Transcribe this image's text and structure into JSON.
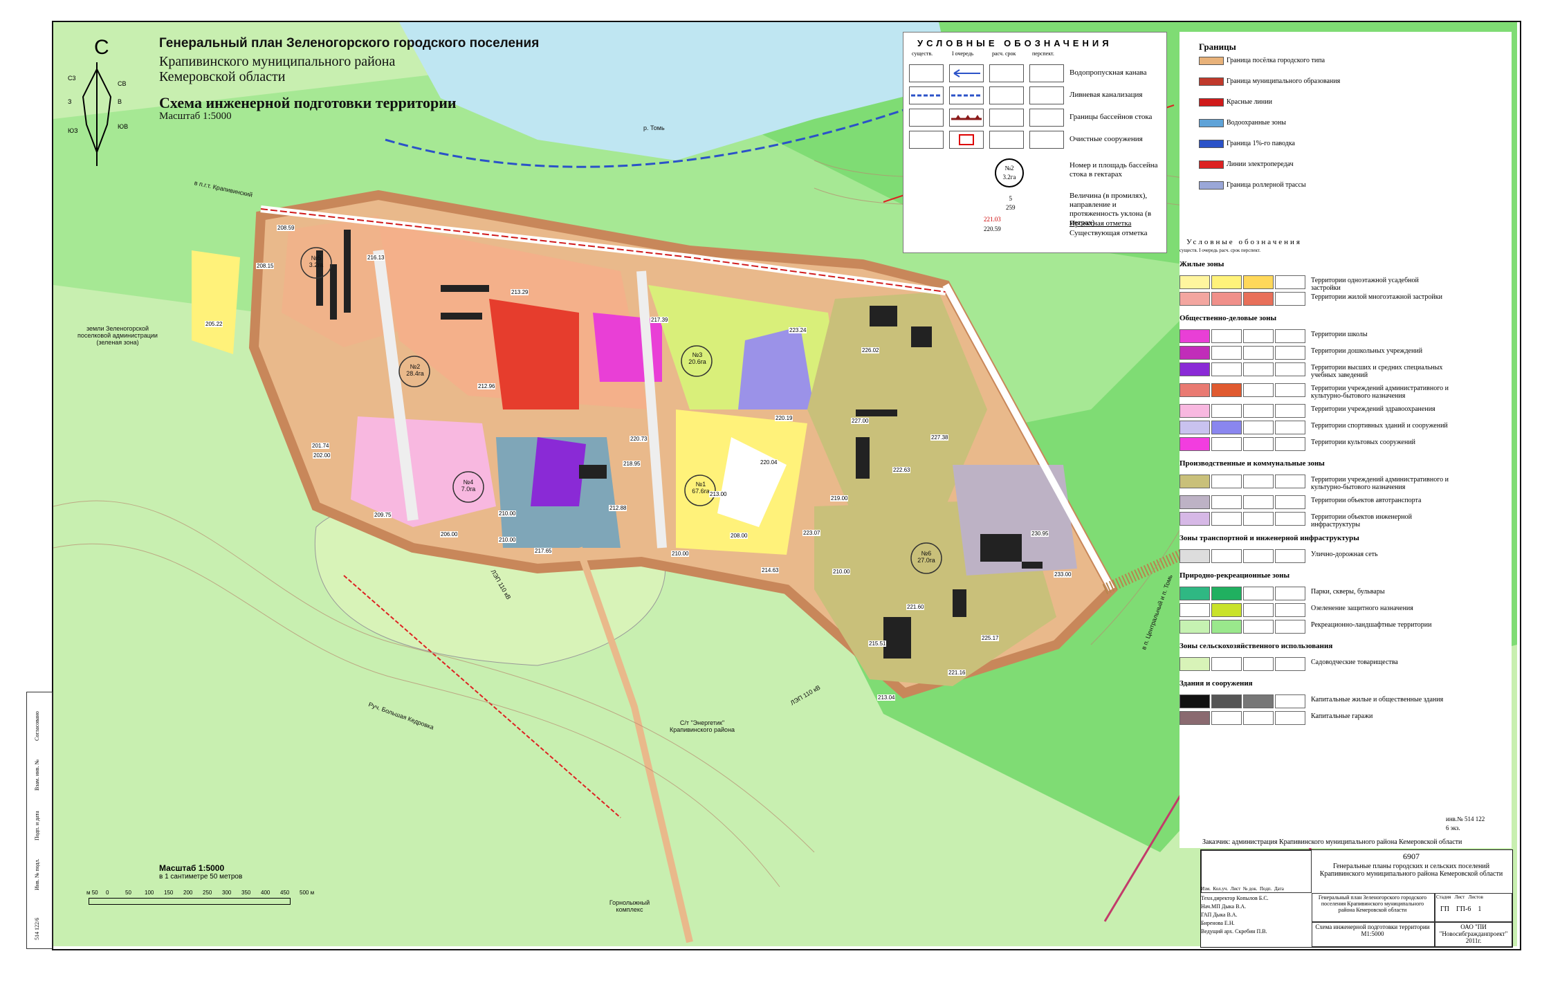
{
  "title": {
    "line1": "Генеральный план Зеленогорского городского поселения",
    "line2": "Крапивинского муниципального района",
    "line3": "Кемеровской области",
    "scheme": "Схема инженерной подготовки территории",
    "scale": "Масштаб 1:5000"
  },
  "north": "С",
  "compass": [
    "С3",
    "СВ",
    "З",
    "В",
    "ЮЗ",
    "ЮВ"
  ],
  "map_labels": {
    "river": "р. Томь",
    "village_lands": "земли Зеленогорской поселковой администрации (зеленая зона)",
    "dacha": "С/т \"Энергетик\" Крапивинского района",
    "ski": "Горнолыжный комплекс",
    "stream": "Руч. Большая Кедровка",
    "road_krap": "в п.г.т. Крапивинский",
    "road_central": "в п. Центральный и п. Томь",
    "lep1": "ЛЭП 110 кВ",
    "lep2": "ЛЭП 110 кВ"
  },
  "basins": [
    {
      "id": "№1",
      "area": "67.6га"
    },
    {
      "id": "№2",
      "area": "28.4га"
    },
    {
      "id": "№3",
      "area": "20.6га"
    },
    {
      "id": "№4",
      "area": "7.0га"
    },
    {
      "id": "№5",
      "area": "3.2га"
    },
    {
      "id": "№6",
      "area": "27.0га"
    }
  ],
  "elevations": [
    "208.59",
    "216.13",
    "213.29",
    "217.39",
    "223.24",
    "226.02",
    "227.38",
    "222.63",
    "230.95",
    "233.00",
    "225.17",
    "221.16",
    "213.04",
    "221.60",
    "215.51",
    "210.00",
    "214.63",
    "208.00",
    "220.04",
    "210.00",
    "212.88",
    "210.00",
    "206.00",
    "201.74",
    "202.00",
    "205.22",
    "208.15",
    "212.96",
    "220.73",
    "218.95",
    "213.00",
    "209.75",
    "217.65",
    "210.00",
    "223.07",
    "219.00",
    "227.00",
    "220.19"
  ],
  "legend1": {
    "heading": "УСЛОВНЫЕ ОБОЗНАЧЕНИЯ",
    "cols": [
      "существ.",
      "I очередь",
      "расч. срок",
      "перспект."
    ],
    "rows": [
      {
        "label": "Водопропускная канава"
      },
      {
        "label": "Ливневая канализация"
      },
      {
        "label": "Границы бассейнов стока"
      },
      {
        "label": "Очистные сооружения"
      },
      {
        "label": "Номер и площадь бассейна стока в гектарах"
      },
      {
        "label": "Величина (в промилях), направление и протяженность уклона (в метрах)"
      },
      {
        "label": "Проектная отметка"
      },
      {
        "label": "Существующая отметка"
      }
    ],
    "sample_basin": {
      "id": "№2",
      "area": "3.2га"
    },
    "sample_slope": {
      "value": "5",
      "length": "259"
    },
    "sample_elev": {
      "project": "221.03",
      "exist": "220.59"
    }
  },
  "legend_borders": {
    "heading": "Границы",
    "items": [
      {
        "label": "Граница посёлка городского типа",
        "color": "#e8b27a"
      },
      {
        "label": "Граница муниципального образования",
        "color": "#c0392b"
      },
      {
        "label": "Красные линии",
        "color": "#d01a1a"
      },
      {
        "label": "Водоохранные зоны",
        "color": "#5fa3d8"
      },
      {
        "label": "Граница 1%-го паводка",
        "color": "#2b52c8"
      },
      {
        "label": "Линии электропередач",
        "color": "#d22"
      },
      {
        "label": "Граница роллерной трассы",
        "color": "#9aa7d8"
      }
    ]
  },
  "legend2": {
    "heading": "Условные обозначения",
    "cols": [
      "существ.",
      "I очередь",
      "расч. срок",
      "перспект."
    ],
    "sections": [
      {
        "title": "Жилые зоны",
        "items": [
          {
            "label": "Территории одноэтажной усадебной застройки",
            "colors": [
              "#fff59e",
              "#fff27a",
              "#ffd85a",
              "#ffffff"
            ]
          },
          {
            "label": "Территории жилой многоэтажной застройки",
            "colors": [
              "#f3a6a0",
              "#f0908a",
              "#e8705a",
              "#ffffff"
            ]
          }
        ]
      },
      {
        "title": "Общественно-деловые зоны",
        "items": [
          {
            "label": "Территории школы",
            "colors": [
              "#e93fd6",
              "#ffffff",
              "#ffffff",
              "#ffffff"
            ]
          },
          {
            "label": "Территории дошкольных учреждений",
            "colors": [
              "#c12db9",
              "#ffffff",
              "#ffffff",
              "#ffffff"
            ]
          },
          {
            "label": "Территории высших и средних специальных учебных заведений",
            "colors": [
              "#8a2ad6",
              "#ffffff",
              "#ffffff",
              "#ffffff"
            ]
          },
          {
            "label": "Территории учреждений административного и культурно-бытового назначения",
            "colors": [
              "#e97a72",
              "#e05a30",
              "#ffffff",
              "#ffffff"
            ]
          },
          {
            "label": "Территории учреждений здравоохранения",
            "colors": [
              "#f8b8e0",
              "#ffffff",
              "#ffffff",
              "#ffffff"
            ]
          },
          {
            "label": "Территории спортивных зданий и сооружений",
            "colors": [
              "#c9c2ef",
              "#8a86ef",
              "#ffffff",
              "#ffffff"
            ]
          },
          {
            "label": "Территории культовых сооружений",
            "colors": [
              "#f23ddf",
              "#ffffff",
              "#ffffff",
              "#ffffff"
            ]
          }
        ]
      },
      {
        "title": "Производственные и коммунальные зоны",
        "items": [
          {
            "label": "Территории учреждений административного и культурно-бытового назначения",
            "colors": [
              "#c9c07a",
              "#ffffff",
              "#ffffff",
              "#ffffff"
            ]
          },
          {
            "label": "Территории объектов автотранспорта",
            "colors": [
              "#bdb2c5",
              "#ffffff",
              "#ffffff",
              "#ffffff"
            ]
          },
          {
            "label": "Территории объектов инженерной инфраструктуры",
            "colors": [
              "#d6b8e6",
              "#ffffff",
              "#ffffff",
              "#ffffff"
            ]
          }
        ]
      },
      {
        "title": "Зоны транспортной и инженерной инфраструктуры",
        "items": [
          {
            "label": "Улично-дорожная сеть",
            "colors": [
              "#dddddd",
              "#ffffff",
              "#ffffff",
              "#ffffff"
            ]
          }
        ]
      },
      {
        "title": "Природно-рекреационные зоны",
        "items": [
          {
            "label": "Парки, скверы, бульвары",
            "colors": [
              "#2fb883",
              "#20b060",
              "#ffffff",
              "#ffffff"
            ]
          },
          {
            "label": "Озеленение защитного назначения",
            "colors": [
              "#ffffff",
              "#c9e22a",
              "#ffffff",
              "#ffffff"
            ]
          },
          {
            "label": "Рекреационно-ландшафтные территории",
            "colors": [
              "#c6f2b2",
              "#9ae88c",
              "#ffffff",
              "#ffffff"
            ]
          }
        ]
      },
      {
        "title": "Зоны сельскохозяйственного использования",
        "items": [
          {
            "label": "Садоводческие товарищества",
            "colors": [
              "#d8f3b8",
              "#ffffff",
              "#ffffff",
              "#ffffff"
            ]
          }
        ]
      },
      {
        "title": "Здания и сооружения",
        "items": [
          {
            "label": "Капитальные жилые и общественные здания",
            "colors": [
              "#111111",
              "#555555",
              "#777777",
              "#ffffff"
            ]
          },
          {
            "label": "Капитальные гаражи",
            "colors": [
              "#8a6a70",
              "#ffffff",
              "#ffffff",
              "#ffffff"
            ]
          }
        ]
      }
    ]
  },
  "inv_note": "инв.№ 514 122 6 экз.",
  "customer": "Заказчик: администрация Крапивинского муниципального района Кемеровской области",
  "titleblock": {
    "code": "6907",
    "project": "Генеральные планы городских и сельских поселений Крапивинского муниципального района Кемеровской области",
    "doc": "Генеральный план Зеленогорского городского поселения Крапивинского муниципального района Кемеровской области",
    "cols": [
      "Изм.",
      "Кол.уч.",
      "Лист",
      "№ док.",
      "Подп.",
      "Дата"
    ],
    "roles": [
      "Техн.директор",
      "Нач.МП",
      "ГАП",
      "",
      "Ведущий арх."
    ],
    "names": [
      "Копылов Б.С.",
      "Дыка В.А.",
      "Дыка В.А.",
      "Биренова Е.Н.",
      "Скребин П.В."
    ],
    "stage_hdr": [
      "Стадия",
      "Лист",
      "Листов"
    ],
    "stage": [
      "ГП",
      "ГП-6",
      "1"
    ],
    "sheet_title": "Схема инженерной подготовки территории М1:5000",
    "org": "ОАО \"ПИ \"Новосибгражданпроект\" 2011г."
  },
  "scalebar": {
    "title": "Масштаб 1:5000",
    "subtitle": "в 1 сантиметре 50 метров",
    "ticks": [
      "м 50",
      "0",
      "50",
      "100",
      "150",
      "200",
      "250",
      "300",
      "350",
      "400",
      "450",
      "500 м"
    ]
  },
  "side_stamp": [
    "Согласовано",
    "Взам. инв. №",
    "Подп. и дата",
    "Инв. № подл.",
    "514 122/6"
  ]
}
